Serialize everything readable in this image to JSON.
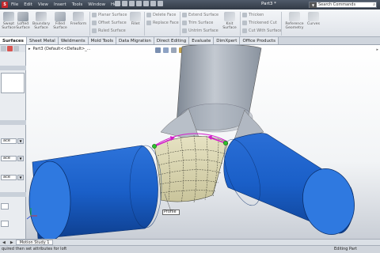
{
  "app": {
    "menus": [
      "File",
      "Edit",
      "View",
      "Insert",
      "Tools",
      "Window",
      "Help"
    ],
    "document_title": "Part3 *",
    "search_placeholder": "Search Commands"
  },
  "toolbar": {
    "buttons": [
      {
        "label": "Swept Surface",
        "name": "swept-surface-button"
      },
      {
        "label": "Lofted Surface",
        "name": "lofted-surface-button"
      },
      {
        "label": "Boundary Surface",
        "name": "boundary-surface-button"
      },
      {
        "label": "Filled Surface",
        "name": "filled-surface-button"
      },
      {
        "label": "Freeform",
        "name": "freeform-button"
      },
      {
        "label": "Fillet",
        "name": "fillet-button"
      },
      {
        "label": "Knit Surface",
        "name": "knit-surface-button"
      },
      {
        "label": "Reference Geometry",
        "name": "reference-geometry-button"
      },
      {
        "label": "Curves",
        "name": "curves-button"
      }
    ],
    "small_buttons": [
      "Planar Surface",
      "Offset Surface",
      "Ruled Surface",
      "Delete Face",
      "Replace Face",
      "Extend Surface",
      "Trim Surface",
      "Untrim Surface",
      "Thicken",
      "Thickened Cut",
      "Cut With Surface"
    ]
  },
  "tabs": [
    "Surfaces",
    "Sheet Metal",
    "Weldments",
    "Mold Tools",
    "Data Migration",
    "Direct Editing",
    "Evaluate",
    "DimXpert",
    "Office Products"
  ],
  "active_tab": "Surfaces",
  "property_manager": {
    "dropdown_1": "ace",
    "dropdown_2": "ace",
    "dropdown_3": "ace"
  },
  "graphics": {
    "feature_tree_title": "Part3  (Default<<Default>_..."
  },
  "callout": {
    "label": "Profile"
  },
  "bottom_tab": "Motion Study 1",
  "status": {
    "message": "quired then set attributes for loft",
    "mode": "Editing Part"
  },
  "colors": {
    "tube_blue": "#1a5fc8",
    "tube_gray": "#9ea7b3",
    "loft_surface": "#ddd9b4",
    "handle_magenta": "#d21ec8",
    "point_green": "#2ec22e"
  }
}
